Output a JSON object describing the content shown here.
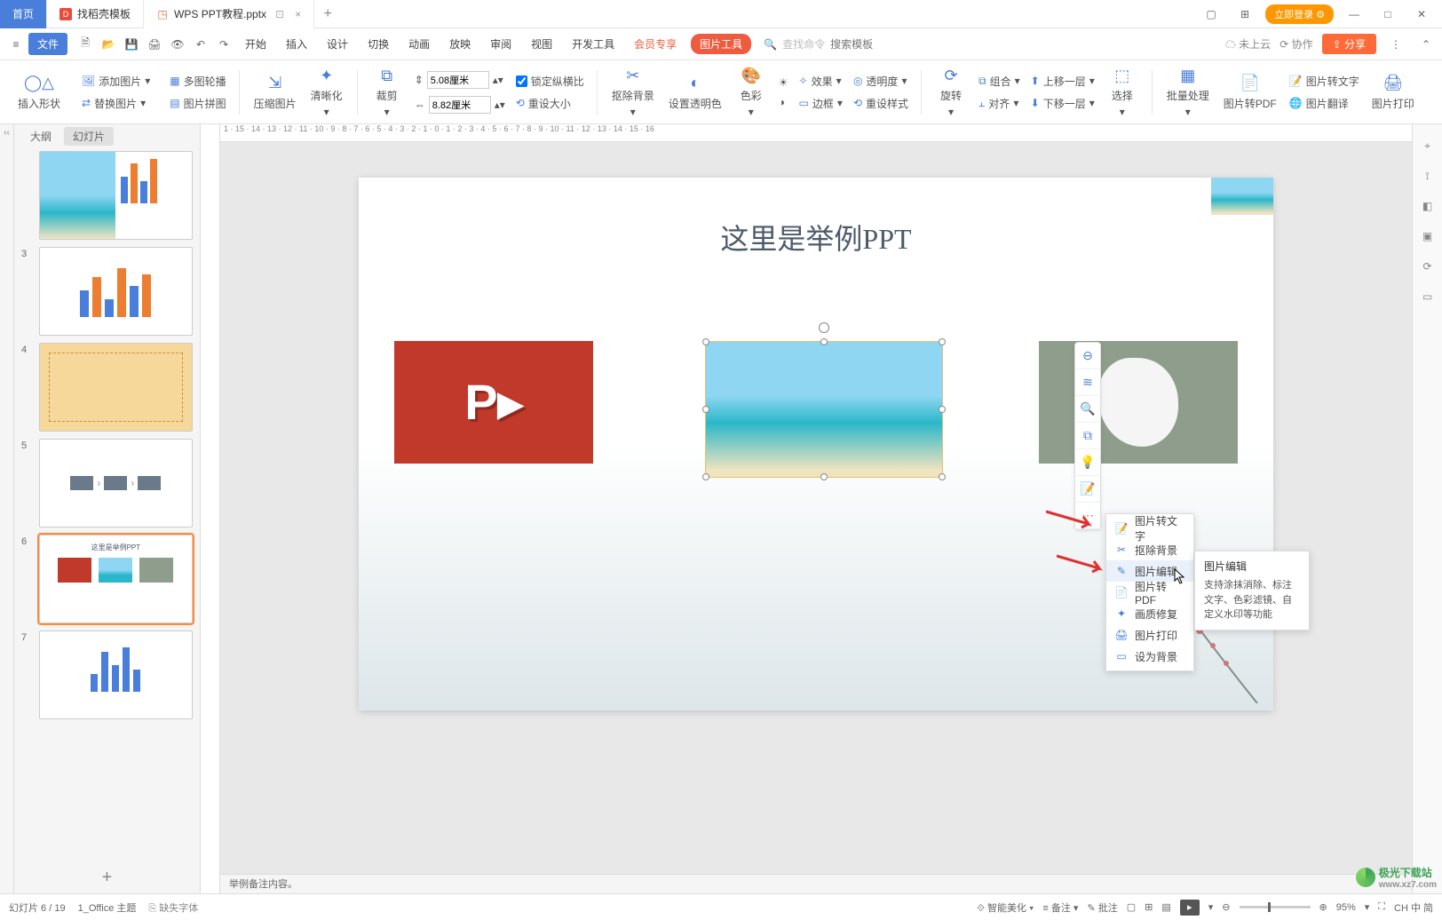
{
  "titlebar": {
    "home_tab": "首页",
    "tab2": "找稻壳模板",
    "tab3": "WPS PPT教程.pptx",
    "login": "立即登录"
  },
  "menubar": {
    "file": "文件",
    "items": [
      "开始",
      "插入",
      "设计",
      "切换",
      "动画",
      "放映",
      "审阅",
      "视图",
      "开发工具",
      "会员专享"
    ],
    "pic_tool": "图片工具",
    "search_hint": "查找命令",
    "search_placeholder": "搜索模板",
    "cloud": "未上云",
    "coop": "协作",
    "share": "分享"
  },
  "ribbon": {
    "insert_shape": "插入形状",
    "add_pic": "添加图片",
    "multi_outline": "多图轮播",
    "replace_pic": "替换图片",
    "pic_merge": "图片拼图",
    "compress": "压缩图片",
    "sharpen": "清晰化",
    "crop": "裁剪",
    "height": "5.08厘米",
    "width": "8.82厘米",
    "lock_ratio": "锁定纵横比",
    "reset_size": "重设大小",
    "remove_bg": "抠除背景",
    "set_transp": "设置透明色",
    "color": "色彩",
    "effect": "效果",
    "transparency": "透明度",
    "border": "边框",
    "reset_style": "重设样式",
    "rotate": "旋转",
    "combine": "组合",
    "align": "对齐",
    "move_up": "上移一层",
    "move_down": "下移一层",
    "select": "选择",
    "batch": "批量处理",
    "to_pdf": "图片转PDF",
    "to_text": "图片转文字",
    "translate": "图片翻译",
    "print": "图片打印"
  },
  "thumb_tabs": {
    "outline": "大纲",
    "slides": "幻灯片"
  },
  "slide_title": "这里是举例PPT",
  "float_tools": [
    "layers",
    "zoom",
    "crop",
    "bulb",
    "text",
    "more"
  ],
  "ctx": {
    "to_text": "图片转文字",
    "remove_bg": "抠除背景",
    "edit": "图片编辑",
    "to_pdf": "图片转PDF",
    "repair": "画质修复",
    "print": "图片打印",
    "set_bg": "设为背景"
  },
  "tooltip": {
    "title": "图片编辑",
    "body": "支持涂抹消除、标注文字、色彩滤镜、自定义水印等功能"
  },
  "notes": "举例备注内容。",
  "status": {
    "slide_pos": "幻灯片 6 / 19",
    "theme": "1_Office 主题",
    "missing_font": "缺失字体",
    "beautify": "智能美化",
    "notes_btn": "备注",
    "review_btn": "批注",
    "zoom": "95%",
    "ime": "CH 中 简"
  },
  "ruler": "1 · 15 · 14 · 13 · 12 · 11 · 10 · 9 · 8 · 7 · 6 · 5 · 4 · 3 · 2 · 1 · 0 · 1 · 2 · 3 · 4 · 5 · 6 · 7 · 8 · 9 · 10 · 11 · 12 · 13 · 14 · 15 · 16",
  "watermark": {
    "name": "极光下载站",
    "url": "www.xz7.com"
  }
}
